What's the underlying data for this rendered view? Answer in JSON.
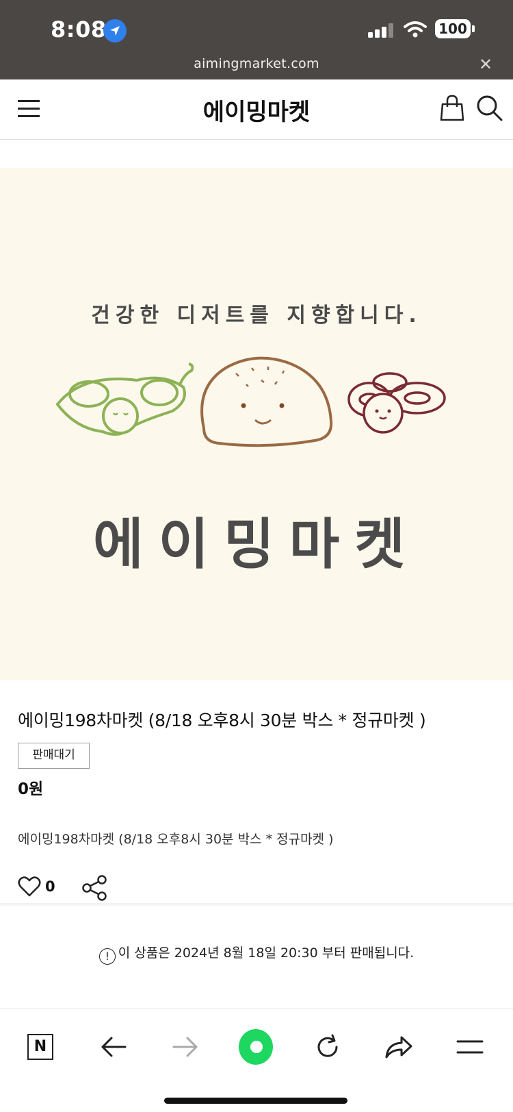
{
  "status_bar": {
    "time": "8:08",
    "battery": "100",
    "url": "aimingmarket.com",
    "close_glyph": "✕",
    "icons": [
      "location-arrow-icon",
      "signal-icon",
      "wifi-icon",
      "battery-icon"
    ]
  },
  "header": {
    "title": "에이밍마켓",
    "icons": [
      "menu-icon",
      "shopping-bag-icon",
      "search-icon"
    ]
  },
  "hero": {
    "subtitle": "건강한 디저트를 지향합니다.",
    "logo_text": "에이밍마켓",
    "illustrations": [
      "edamame-icon",
      "bread-icon",
      "red-bean-icon"
    ],
    "background": "#fdf8ec"
  },
  "product": {
    "title": "에이밍198차마켓 (8/18 오후8시 30분 박스 * 정규마켓 )",
    "status": "판매대기",
    "price": "0원",
    "description": "에이밍198차마켓 (8/18 오후8시 30분 박스 * 정규마켓 )",
    "likes": "0"
  },
  "notice": {
    "icon": "!",
    "text": "이 상품은 2024년 8월 18일 20:30 부터 판매됩니다."
  },
  "browser_bar": {
    "n_logo": "N",
    "items": [
      "n-home-icon",
      "back-arrow-icon",
      "forward-arrow-icon",
      "green-dot-icon",
      "refresh-icon",
      "share-arrow-icon",
      "hamburger-menu-icon"
    ],
    "accent": "#1ed760"
  }
}
